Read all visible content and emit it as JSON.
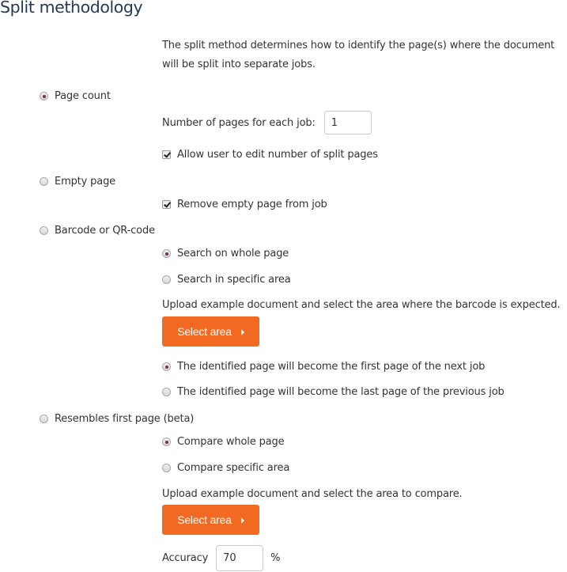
{
  "title": "Split methodology",
  "description": "The split method determines how to identify the page(s) where the document will be split into separate jobs.",
  "methods": {
    "page_count": {
      "label": "Page count",
      "selected": true,
      "pages_label": "Number of pages for each job:",
      "pages_value": "1",
      "allow_edit_label": "Allow user to edit number of split pages",
      "allow_edit_checked": true
    },
    "empty_page": {
      "label": "Empty page",
      "selected": false,
      "remove_label": "Remove empty page from job",
      "remove_checked": true
    },
    "barcode": {
      "label": "Barcode or QR-code",
      "selected": false,
      "search_whole_label": "Search on whole page",
      "search_area_label": "Search in specific area",
      "search_mode": "whole",
      "upload_hint": "Upload example document and select the area where the barcode is expected.",
      "select_area_label": "Select area",
      "first_page_label": "The identified page will become the first page of the next job",
      "last_page_label": "The identified page will become the last page of the previous job",
      "page_position": "first"
    },
    "resembles": {
      "label": "Resembles first page (beta)",
      "selected": false,
      "compare_whole_label": "Compare whole page",
      "compare_area_label": "Compare specific area",
      "compare_mode": "whole",
      "upload_hint": "Upload example document and select the area to compare.",
      "select_area_label": "Select area",
      "accuracy_label": "Accuracy",
      "accuracy_value": "70",
      "accuracy_unit": "%"
    }
  }
}
